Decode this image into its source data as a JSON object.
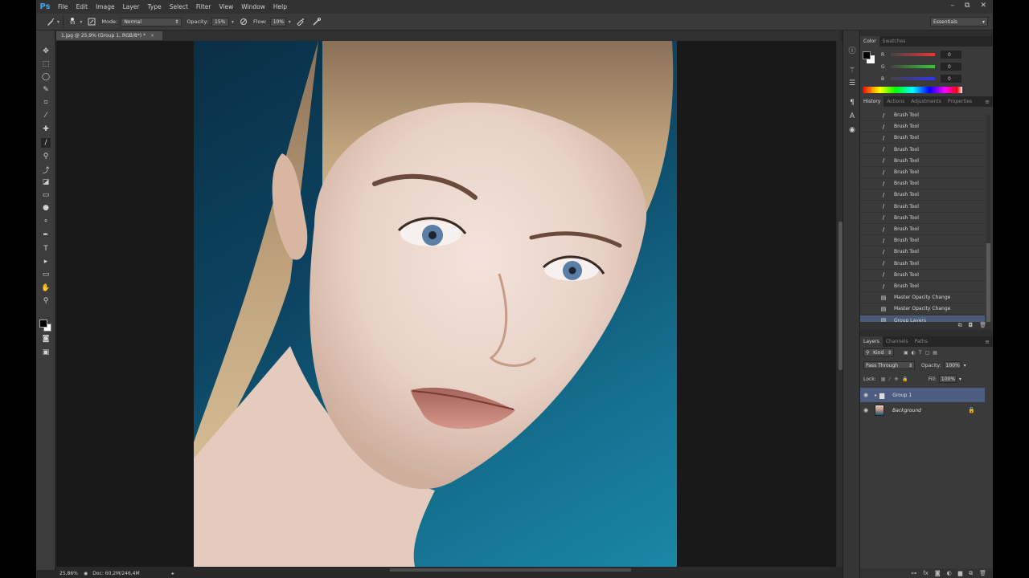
{
  "app": {
    "logo": "Ps"
  },
  "menu": [
    "File",
    "Edit",
    "Image",
    "Layer",
    "Type",
    "Select",
    "Filter",
    "View",
    "Window",
    "Help"
  ],
  "window_controls": {
    "minimize": "–",
    "restore": "⧉",
    "close": "✕"
  },
  "options_bar": {
    "brush_size": "93",
    "mode_label": "Mode:",
    "mode_value": "Normal",
    "opacity_label": "Opacity:",
    "opacity_value": "15%",
    "flow_label": "Flow:",
    "flow_value": "10%",
    "workspace": "Essentials"
  },
  "document_tab": {
    "title": "1.jpg @ 25,9% (Group 1, RGB/8*) *",
    "close": "×"
  },
  "status": {
    "zoom": "25,86%",
    "doc": "Doc: 60,2M/246,4M"
  },
  "color_panel": {
    "tabs": [
      "Color",
      "Swatches"
    ],
    "active_tab": "Color",
    "rows": [
      {
        "label": "R",
        "value": "0",
        "color": "#d23a3a"
      },
      {
        "label": "G",
        "value": "0",
        "color": "#3ab03a"
      },
      {
        "label": "B",
        "value": "0",
        "color": "#3a5ad8"
      }
    ]
  },
  "history_panel": {
    "tabs": [
      "History",
      "Actions",
      "Adjustments",
      "Properties"
    ],
    "active_tab": "History",
    "items": [
      {
        "label": "Brush Tool",
        "icon": "brush-icon"
      },
      {
        "label": "Brush Tool",
        "icon": "brush-icon"
      },
      {
        "label": "Brush Tool",
        "icon": "brush-icon"
      },
      {
        "label": "Brush Tool",
        "icon": "brush-icon"
      },
      {
        "label": "Brush Tool",
        "icon": "brush-icon"
      },
      {
        "label": "Brush Tool",
        "icon": "brush-icon"
      },
      {
        "label": "Brush Tool",
        "icon": "brush-icon"
      },
      {
        "label": "Brush Tool",
        "icon": "brush-icon"
      },
      {
        "label": "Brush Tool",
        "icon": "brush-icon"
      },
      {
        "label": "Brush Tool",
        "icon": "brush-icon"
      },
      {
        "label": "Brush Tool",
        "icon": "brush-icon"
      },
      {
        "label": "Brush Tool",
        "icon": "brush-icon"
      },
      {
        "label": "Brush Tool",
        "icon": "brush-icon"
      },
      {
        "label": "Brush Tool",
        "icon": "brush-icon"
      },
      {
        "label": "Brush Tool",
        "icon": "brush-icon"
      },
      {
        "label": "Brush Tool",
        "icon": "brush-icon"
      },
      {
        "label": "Master Opacity Change",
        "icon": "layer-icon"
      },
      {
        "label": "Master Opacity Change",
        "icon": "layer-icon"
      },
      {
        "label": "Group Layers",
        "icon": "layer-icon"
      }
    ],
    "selected_index": 18
  },
  "layers_panel": {
    "tabs": [
      "Layers",
      "Channels",
      "Paths"
    ],
    "active_tab": "Layers",
    "kind_label": "Kind",
    "blend_mode": "Pass Through",
    "opacity_label": "Opacity:",
    "opacity_value": "100%",
    "lock_label": "Lock:",
    "fill_label": "Fill:",
    "fill_value": "100%",
    "layers": [
      {
        "name": "Group 1",
        "type": "group",
        "selected": true
      },
      {
        "name": "Background",
        "type": "image",
        "selected": false,
        "locked": true
      }
    ]
  }
}
